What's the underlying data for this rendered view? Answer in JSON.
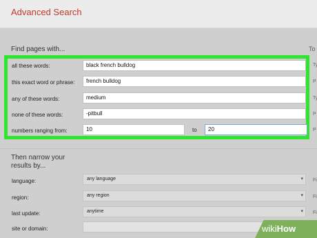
{
  "page": {
    "title": "Advanced Search"
  },
  "find_section": {
    "heading": "Find pages with...",
    "right_hint": "To do",
    "rows": [
      {
        "label": "all these words:",
        "value": "black french bulldog",
        "hint": "Ty"
      },
      {
        "label": "this exact word or phrase:",
        "value": "french bulldog",
        "hint": "P"
      },
      {
        "label": "any of these words:",
        "value": "medium",
        "hint": "Ty"
      },
      {
        "label": "none of these words:",
        "value": "-pitbull",
        "hint": "P"
      },
      {
        "label": "numbers ranging from:",
        "value": "10",
        "to_label": "to",
        "value_to": "20",
        "hint": "P"
      }
    ]
  },
  "narrow_section": {
    "heading": "Then narrow your results by...",
    "rows": [
      {
        "label": "language:",
        "value": "any language",
        "hint": "Fi"
      },
      {
        "label": "region:",
        "value": "any region",
        "hint": "Fi"
      },
      {
        "label": "last update:",
        "value": "anytime",
        "hint": "Fi"
      },
      {
        "label": "site or domain:",
        "value": "",
        "hint": ""
      }
    ]
  },
  "watermark": {
    "text_a": "wiki",
    "text_b": "How"
  },
  "colors": {
    "highlight": "#2ee62e",
    "title": "#c0392b",
    "watermark": "#7fb05a"
  }
}
